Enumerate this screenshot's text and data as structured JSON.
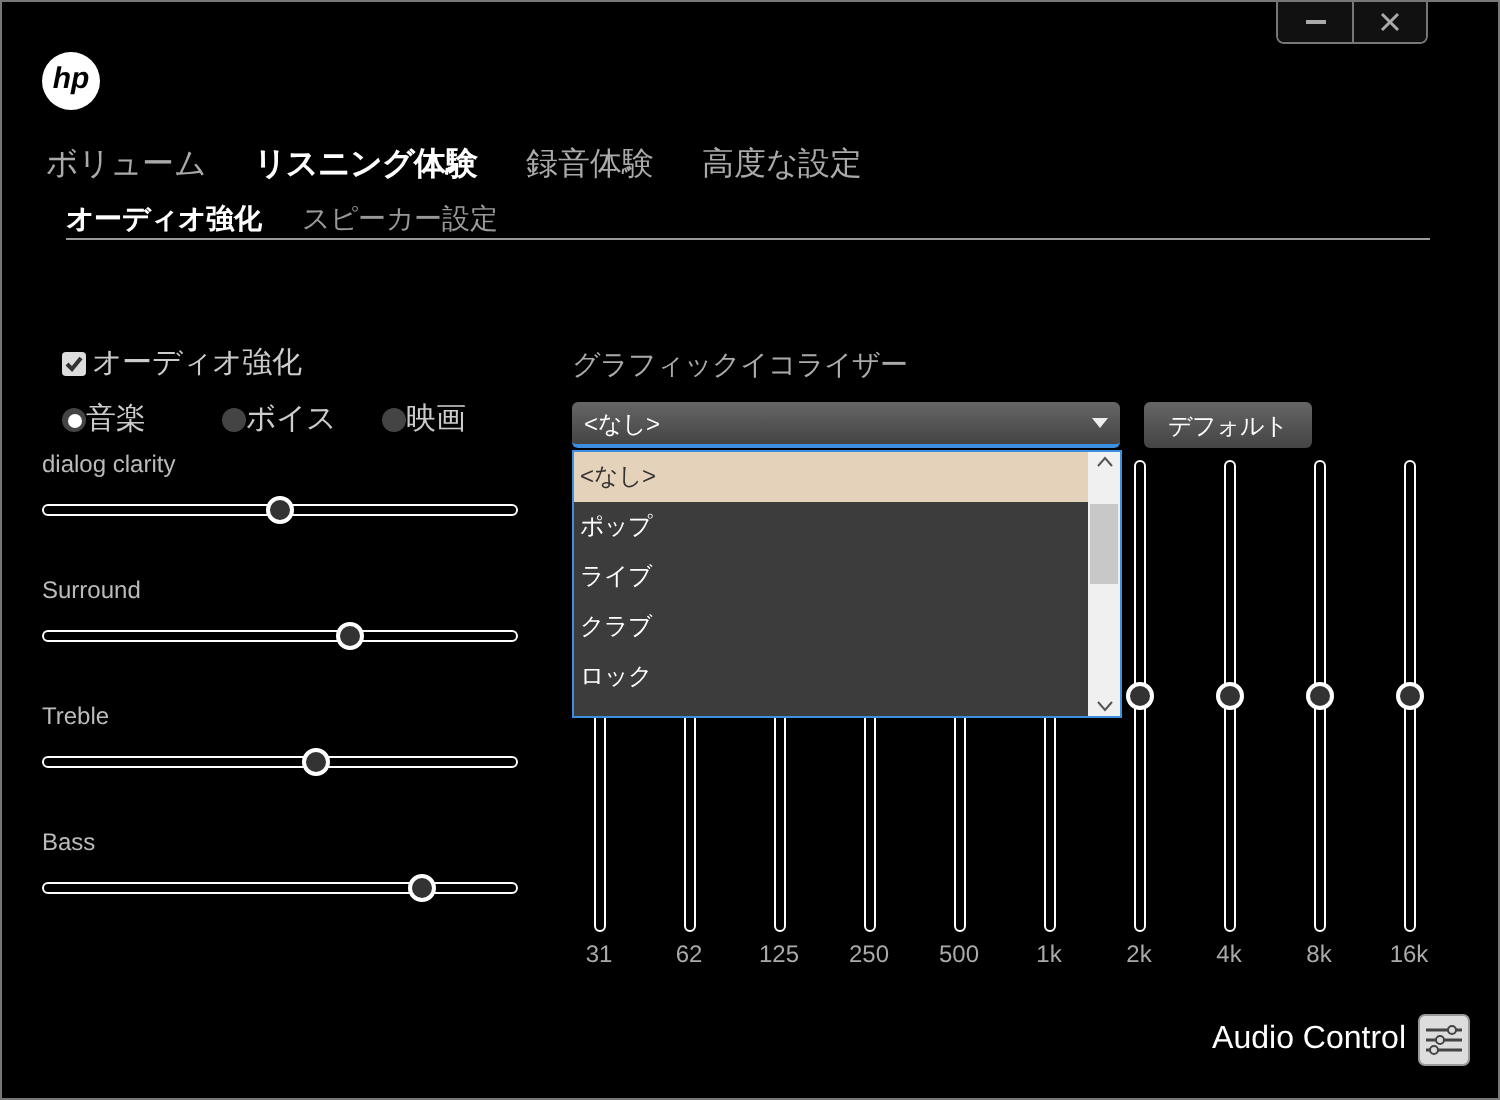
{
  "window_controls": [
    {
      "kind": "minimize"
    },
    {
      "kind": "close"
    }
  ],
  "logo": "hp",
  "tabs": [
    {
      "label": "ボリューム",
      "selected": false
    },
    {
      "label": "リスニング体験",
      "selected": true
    },
    {
      "label": "録音体験",
      "selected": false
    },
    {
      "label": "高度な設定",
      "selected": false
    }
  ],
  "subtabs": [
    {
      "label": "オーディオ強化",
      "selected": true
    },
    {
      "label": "スピーカー設定",
      "selected": false
    }
  ],
  "audio_enhancement": {
    "label": "オーディオ強化",
    "checked": true
  },
  "modes": [
    {
      "label": "音楽",
      "selected": true
    },
    {
      "label": "ボイス",
      "selected": false
    },
    {
      "label": "映画",
      "selected": false
    }
  ],
  "sliders": [
    {
      "label": "dialog clarity",
      "level": 0.5
    },
    {
      "label": "Surround",
      "level": 0.65
    },
    {
      "label": "Treble",
      "level": 0.575
    },
    {
      "label": "Bass",
      "level": 0.8
    }
  ],
  "equalizer": {
    "title": "グラフィックイコライザー",
    "preset": "<なし>",
    "default_button": "デフォルト",
    "dropdown": {
      "expanded": true,
      "options": [
        {
          "label": "<なし>",
          "selected": true
        },
        {
          "label": "ポップ",
          "selected": false
        },
        {
          "label": "ライブ",
          "selected": false
        },
        {
          "label": "クラブ",
          "selected": false
        },
        {
          "label": "ロック",
          "selected": false
        }
      ]
    },
    "bands": [
      {
        "label": "31"
      },
      {
        "label": "62"
      },
      {
        "label": "125"
      },
      {
        "label": "250"
      },
      {
        "label": "500"
      },
      {
        "label": "1k"
      },
      {
        "label": "2k",
        "level": 0.5
      },
      {
        "label": "4k",
        "level": 0.5
      },
      {
        "label": "8k",
        "level": 0.5
      },
      {
        "label": "16k",
        "level": 0.5
      }
    ]
  },
  "footer": {
    "label": "Audio Control"
  }
}
